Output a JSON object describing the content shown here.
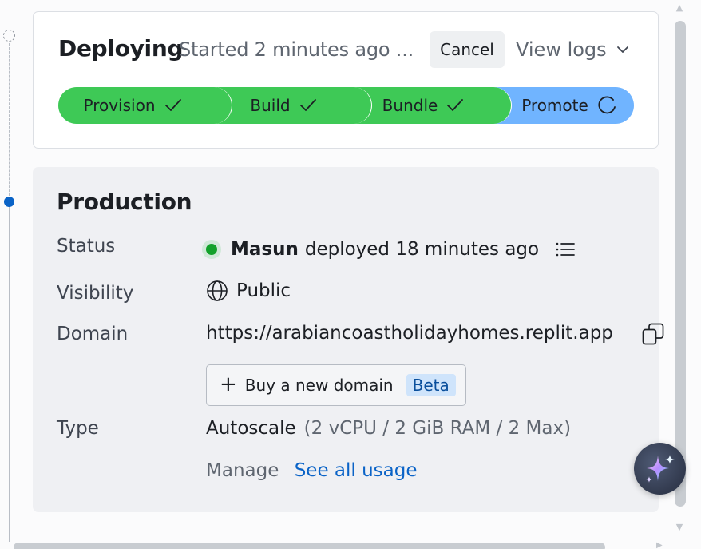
{
  "deployment": {
    "title": "Deploying",
    "started": "Started 2 minutes ago ...",
    "cancel_label": "Cancel",
    "view_logs_label": "View logs",
    "stages": [
      {
        "label": "Provision",
        "state": "done"
      },
      {
        "label": "Build",
        "state": "done"
      },
      {
        "label": "Bundle",
        "state": "done"
      },
      {
        "label": "Promote",
        "state": "in-progress"
      }
    ]
  },
  "production": {
    "title": "Production",
    "status": {
      "label": "Status",
      "user": "Masun",
      "text": "deployed 18 minutes ago"
    },
    "visibility": {
      "label": "Visibility",
      "value": "Public"
    },
    "domain": {
      "label": "Domain",
      "url": "https://arabiancoastholidayhomes.replit.app",
      "buy_label": "Buy a new domain",
      "beta_badge": "Beta"
    },
    "type": {
      "label": "Type",
      "value": "Autoscale",
      "spec": "(2 vCPU / 2 GiB RAM / 2 Max)",
      "manage_label": "Manage",
      "usage_link": "See all usage"
    }
  },
  "icons": {
    "view_logs": "chevron-down-icon",
    "stage_done": "check-icon",
    "stage_active": "spinner-icon",
    "status": "status-dot-icon",
    "history": "list-icon",
    "visibility": "globe-icon",
    "copy": "copy-icon",
    "buy": "plus-icon",
    "assistant": "sparkle-icon"
  },
  "colors": {
    "stage_done": "#3ec956",
    "stage_active": "#70b4ff",
    "status_dot": "#12a12a",
    "link": "#0a63c7",
    "beta_bg": "#cfe4fb",
    "timeline_active": "#0a63c7"
  }
}
